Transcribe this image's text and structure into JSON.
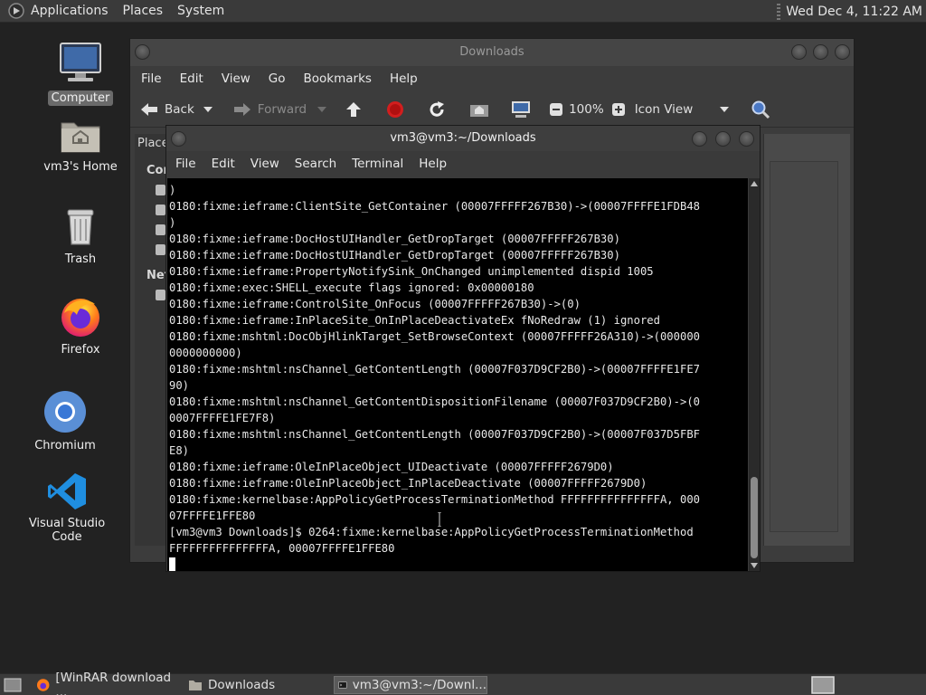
{
  "top_panel": {
    "menus": [
      "Applications",
      "Places",
      "System"
    ],
    "clock": "Wed Dec  4, 11:22 AM"
  },
  "desktop_icons": [
    {
      "label": "Computer",
      "icon": "computer-icon"
    },
    {
      "label": "vm3's Home",
      "icon": "home-folder-icon"
    },
    {
      "label": "Trash",
      "icon": "trash-icon"
    },
    {
      "label": "Firefox",
      "icon": "firefox-icon"
    },
    {
      "label": "Chromium",
      "icon": "chromium-icon"
    },
    {
      "label": "Visual Studio Code",
      "icon": "vscode-icon"
    }
  ],
  "file_manager": {
    "title": "Downloads",
    "menu": [
      "File",
      "Edit",
      "View",
      "Go",
      "Bookmarks",
      "Help"
    ],
    "toolbar": {
      "back": "Back",
      "forward": "Forward",
      "zoom": "100%",
      "view_mode": "Icon View"
    },
    "sidebar": {
      "places": "Place",
      "computer": "Cor",
      "network": "Net"
    }
  },
  "terminal": {
    "title": "vm3@vm3:~/Downloads",
    "menu": [
      "File",
      "Edit",
      "View",
      "Search",
      "Terminal",
      "Help"
    ],
    "lines": [
      ")",
      "0180:fixme:ieframe:ClientSite_GetContainer (00007FFFFF267B30)->(00007FFFFE1FDB48",
      ")",
      "0180:fixme:ieframe:DocHostUIHandler_GetDropTarget (00007FFFFF267B30)",
      "0180:fixme:ieframe:DocHostUIHandler_GetDropTarget (00007FFFFF267B30)",
      "0180:fixme:ieframe:PropertyNotifySink_OnChanged unimplemented dispid 1005",
      "0180:fixme:exec:SHELL_execute flags ignored: 0x00000180",
      "0180:fixme:ieframe:ControlSite_OnFocus (00007FFFFF267B30)->(0)",
      "0180:fixme:ieframe:InPlaceSite_OnInPlaceDeactivateEx fNoRedraw (1) ignored",
      "0180:fixme:mshtml:DocObjHlinkTarget_SetBrowseContext (00007FFFFF26A310)->(000000",
      "0000000000)",
      "0180:fixme:mshtml:nsChannel_GetContentLength (00007F037D9CF2B0)->(00007FFFFE1FE7",
      "90)",
      "0180:fixme:mshtml:nsChannel_GetContentDispositionFilename (00007F037D9CF2B0)->(0",
      "0007FFFFE1FE7F8)",
      "0180:fixme:mshtml:nsChannel_GetContentLength (00007F037D9CF2B0)->(00007F037D5FBF",
      "E8)",
      "0180:fixme:ieframe:OleInPlaceObject_UIDeactivate (00007FFFFF2679D0)",
      "0180:fixme:ieframe:OleInPlaceObject_InPlaceDeactivate (00007FFFFF2679D0)",
      "0180:fixme:kernelbase:AppPolicyGetProcessTerminationMethod FFFFFFFFFFFFFFFA, 000",
      "07FFFFE1FFE80",
      "[vm3@vm3 Downloads]$ 0264:fixme:kernelbase:AppPolicyGetProcessTerminationMethod",
      "FFFFFFFFFFFFFFFA, 00007FFFFE1FFE80"
    ]
  },
  "taskbar": {
    "tasks": [
      {
        "label": "[WinRAR download ...",
        "icon": "firefox-icon",
        "active": false
      },
      {
        "label": "Downloads",
        "icon": "folder-icon",
        "active": false
      },
      {
        "label": "vm3@vm3:~/Downl...",
        "icon": "terminal-icon",
        "active": true
      }
    ]
  }
}
